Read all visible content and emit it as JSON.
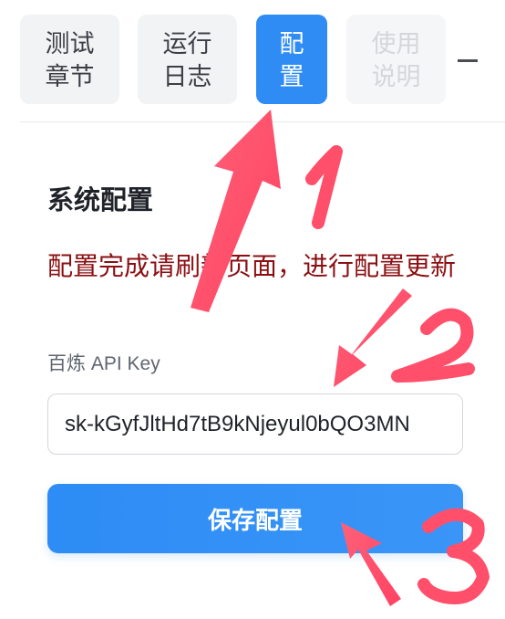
{
  "tabs": [
    {
      "line1": "测试",
      "line2": "章节",
      "state": "normal"
    },
    {
      "line1": "运行",
      "line2": "日志",
      "state": "normal"
    },
    {
      "line1": "配",
      "line2": "置",
      "state": "active"
    },
    {
      "line1": "使用",
      "line2": "说明",
      "state": "disabled"
    }
  ],
  "section": {
    "title": "系统配置",
    "notice": "配置完成请刷新页面，进行配置更新"
  },
  "api_field": {
    "label": "百炼 API Key",
    "value": "sk-kGyfJltHd7tB9kNjeyul0bQO3MN"
  },
  "save_button": {
    "label": "保存配置"
  },
  "annotations": {
    "step1": "1",
    "step2": "2",
    "step3": "3",
    "color": "#ff4f6a"
  },
  "colors": {
    "accent": "#2f8cf4",
    "notice": "#8b0f12"
  }
}
